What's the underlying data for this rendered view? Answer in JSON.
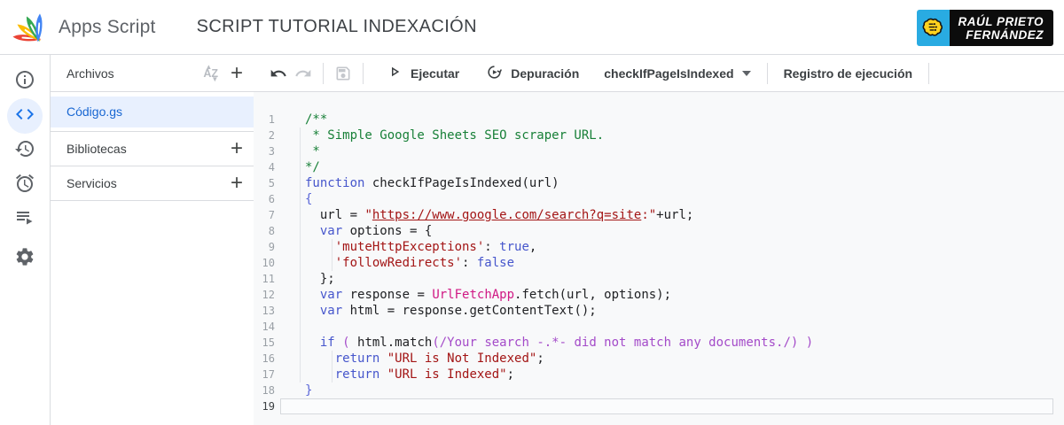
{
  "header": {
    "product": "Apps Script",
    "title": "SCRIPT TUTORIAL INDEXACIÓN",
    "badge": {
      "line1": "RAÚL PRIETO",
      "line2": "FERNÁNDEZ"
    }
  },
  "rail": {
    "items": [
      {
        "name": "info"
      },
      {
        "name": "editor",
        "selected": true
      },
      {
        "name": "history"
      },
      {
        "name": "triggers"
      },
      {
        "name": "executions"
      },
      {
        "name": "settings"
      }
    ]
  },
  "files": {
    "header": "Archivos",
    "items": [
      {
        "label": "Código.gs",
        "selected": true
      }
    ],
    "sections": [
      {
        "label": "Bibliotecas"
      },
      {
        "label": "Servicios"
      }
    ]
  },
  "toolbar": {
    "run": "Ejecutar",
    "debug": "Depuración",
    "function_selected": "checkIfPageIsIndexed",
    "log": "Registro de ejecución"
  },
  "colors": {
    "accent_blue": "#1a73e8",
    "selection_bg": "#e8f0fe",
    "badge_blue": "#29abe2",
    "comment_green": "#188038",
    "keyword_blue": "#4656cc",
    "string_red": "#a31515",
    "service_pink": "#d01884",
    "regex_purple": "#a44bc9"
  },
  "editor": {
    "active_line": 19,
    "lines": [
      {
        "n": 1,
        "tokens": [
          {
            "t": "/**",
            "c": "com"
          }
        ]
      },
      {
        "n": 2,
        "tokens": [
          {
            "t": " * Simple Google Sheets SEO scraper URL.",
            "c": "com"
          }
        ]
      },
      {
        "n": 3,
        "tokens": [
          {
            "t": " *",
            "c": "com"
          }
        ]
      },
      {
        "n": 4,
        "tokens": [
          {
            "t": "*/",
            "c": "com"
          }
        ]
      },
      {
        "n": 5,
        "tokens": [
          {
            "t": "function",
            "c": "kw"
          },
          {
            "t": " checkIfPageIsIndexed(url)",
            "c": "def"
          }
        ]
      },
      {
        "n": 6,
        "tokens": [
          {
            "t": "{",
            "c": "br"
          }
        ]
      },
      {
        "n": 7,
        "tokens": [
          {
            "t": "  url = ",
            "c": "def"
          },
          {
            "t": "\"",
            "c": "str"
          },
          {
            "t": "https://www.google.com/search?q=site",
            "c": "lnk"
          },
          {
            "t": ":\"",
            "c": "str"
          },
          {
            "t": "+url;",
            "c": "def"
          }
        ]
      },
      {
        "n": 8,
        "tokens": [
          {
            "t": "  ",
            "c": "def"
          },
          {
            "t": "var",
            "c": "kw"
          },
          {
            "t": " options = {",
            "c": "def"
          }
        ]
      },
      {
        "n": 9,
        "tokens": [
          {
            "t": "    ",
            "c": "def"
          },
          {
            "t": "'muteHttpExceptions'",
            "c": "str"
          },
          {
            "t": ": ",
            "c": "def"
          },
          {
            "t": "true",
            "c": "kw"
          },
          {
            "t": ",",
            "c": "def"
          }
        ]
      },
      {
        "n": 10,
        "tokens": [
          {
            "t": "    ",
            "c": "def"
          },
          {
            "t": "'followRedirects'",
            "c": "str"
          },
          {
            "t": ": ",
            "c": "def"
          },
          {
            "t": "false",
            "c": "kw"
          }
        ]
      },
      {
        "n": 11,
        "tokens": [
          {
            "t": "  };",
            "c": "def"
          }
        ]
      },
      {
        "n": 12,
        "tokens": [
          {
            "t": "  ",
            "c": "def"
          },
          {
            "t": "var",
            "c": "kw"
          },
          {
            "t": " response = ",
            "c": "def"
          },
          {
            "t": "UrlFetchApp",
            "c": "svc"
          },
          {
            "t": ".fetch(url, options);",
            "c": "def"
          }
        ]
      },
      {
        "n": 13,
        "tokens": [
          {
            "t": "  ",
            "c": "def"
          },
          {
            "t": "var",
            "c": "kw"
          },
          {
            "t": " html = response.getContentText();",
            "c": "def"
          }
        ]
      },
      {
        "n": 14,
        "tokens": []
      },
      {
        "n": 15,
        "tokens": [
          {
            "t": "  ",
            "c": "def"
          },
          {
            "t": "if",
            "c": "kw"
          },
          {
            "t": " ",
            "c": "def"
          },
          {
            "t": "(",
            "c": "pr"
          },
          {
            "t": " html.match",
            "c": "def"
          },
          {
            "t": "(",
            "c": "pr"
          },
          {
            "t": "/Your search -.*- did not match any documents./",
            "c": "re"
          },
          {
            "t": ")",
            "c": "pr"
          },
          {
            "t": " ",
            "c": "def"
          },
          {
            "t": ")",
            "c": "pr"
          }
        ]
      },
      {
        "n": 16,
        "tokens": [
          {
            "t": "    ",
            "c": "def"
          },
          {
            "t": "return",
            "c": "kw"
          },
          {
            "t": " ",
            "c": "def"
          },
          {
            "t": "\"URL is Not Indexed\"",
            "c": "str"
          },
          {
            "t": ";",
            "c": "def"
          }
        ]
      },
      {
        "n": 17,
        "tokens": [
          {
            "t": "    ",
            "c": "def"
          },
          {
            "t": "return",
            "c": "kw"
          },
          {
            "t": " ",
            "c": "def"
          },
          {
            "t": "\"URL is Indexed\"",
            "c": "str"
          },
          {
            "t": ";",
            "c": "def"
          }
        ]
      },
      {
        "n": 18,
        "tokens": [
          {
            "t": "}",
            "c": "br"
          }
        ]
      },
      {
        "n": 19,
        "tokens": []
      }
    ]
  }
}
